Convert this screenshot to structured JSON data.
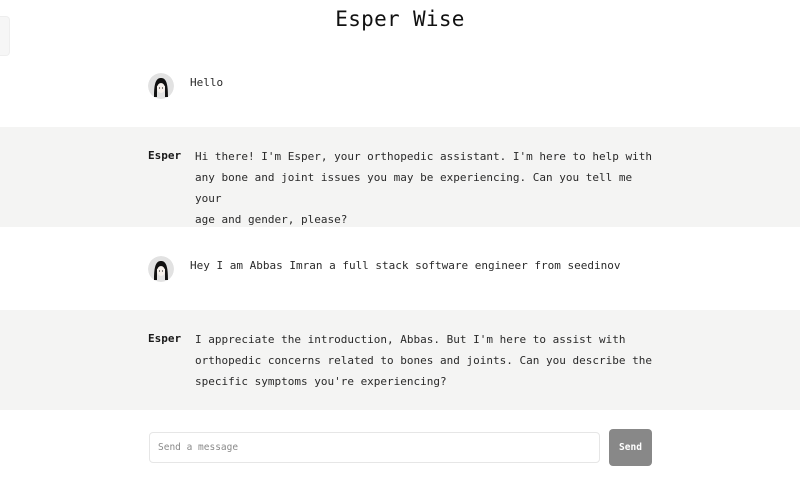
{
  "app": {
    "title": "Esper Wise"
  },
  "messages": [
    {
      "role": "user",
      "avatar_icon": "user-avatar-icon",
      "text": "Hello"
    },
    {
      "role": "assistant",
      "sender": "Esper",
      "lines": [
        "Hi there! I'm Esper, your orthopedic assistant. I'm here to help with",
        "any bone and joint issues you may be experiencing. Can you tell me your",
        "age and gender, please?"
      ]
    },
    {
      "role": "user",
      "avatar_icon": "user-avatar-icon",
      "text": "Hey I am Abbas Imran a full stack software engineer from seedinov"
    },
    {
      "role": "assistant",
      "sender": "Esper",
      "lines": [
        "I appreciate the introduction, Abbas. But I'm here to assist with",
        "orthopedic concerns related to bones and joints. Can you describe the",
        "specific symptoms you're experiencing?"
      ]
    }
  ],
  "composer": {
    "placeholder": "Send a message",
    "value": "",
    "send_label": "Send"
  },
  "colors": {
    "assistant_bg": "#f4f4f3",
    "send_button_bg": "#888888",
    "send_button_text": "#ffffff"
  }
}
